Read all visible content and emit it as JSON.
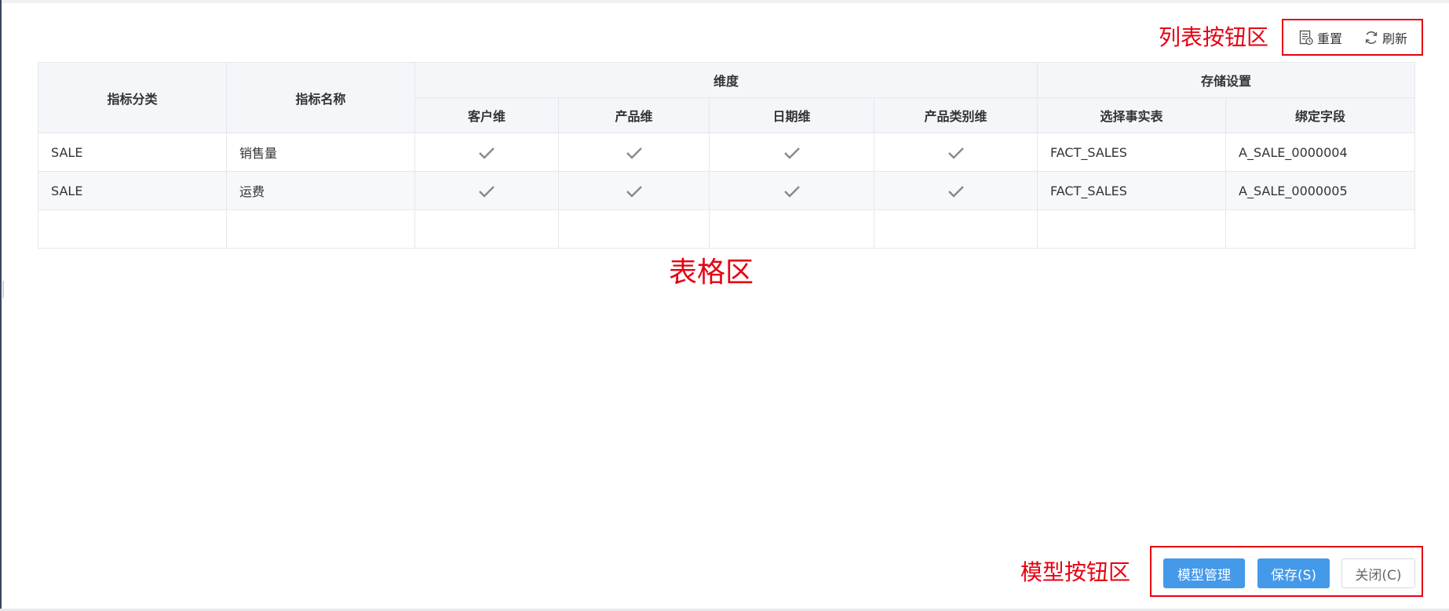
{
  "annotations": {
    "list_buttons_area": "列表按钮区",
    "table_area": "表格区",
    "model_buttons_area": "模型按钮区"
  },
  "toolbar": {
    "reset_label": "重置",
    "reset_icon": "reset-form-icon",
    "refresh_label": "刷新",
    "refresh_icon": "refresh-icon"
  },
  "table": {
    "group_headers": {
      "dimension": "维度",
      "storage": "存储设置"
    },
    "headers": {
      "category": "指标分类",
      "name": "指标名称",
      "customer_dim": "客户维",
      "product_dim": "产品维",
      "date_dim": "日期维",
      "product_category_dim": "产品类别维",
      "fact_table": "选择事实表",
      "bound_field": "绑定字段"
    },
    "rows": [
      {
        "category": "SALE",
        "name": "销售量",
        "customer_dim": true,
        "product_dim": true,
        "date_dim": true,
        "product_category_dim": true,
        "fact_table": "FACT_SALES",
        "bound_field": "A_SALE_0000004"
      },
      {
        "category": "SALE",
        "name": "运费",
        "customer_dim": true,
        "product_dim": true,
        "date_dim": true,
        "product_category_dim": true,
        "fact_table": "FACT_SALES",
        "bound_field": "A_SALE_0000005"
      }
    ]
  },
  "footer": {
    "model_management_label": "模型管理",
    "save_label": "保存(S)",
    "close_label": "关闭(C)"
  },
  "colors": {
    "annotation_red": "#e60012",
    "primary_blue": "#4499e9",
    "header_bg": "#f4f6f9",
    "check_gray": "#8a8a8a"
  }
}
